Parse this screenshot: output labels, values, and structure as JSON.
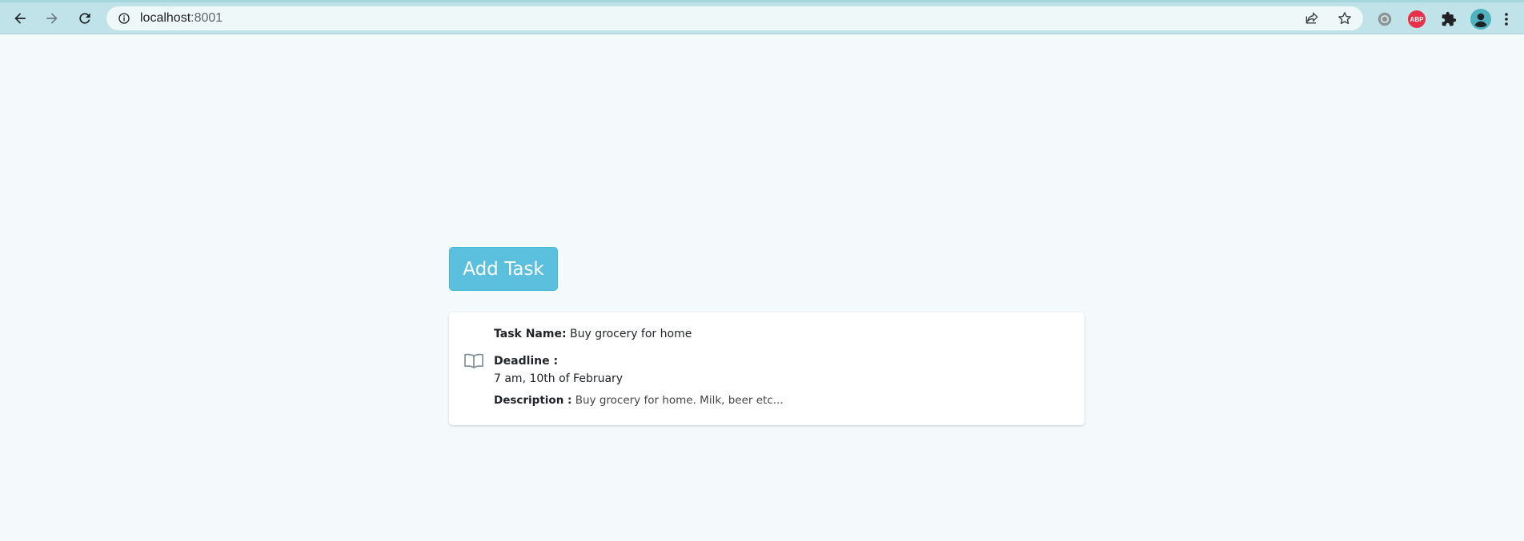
{
  "browser": {
    "url_host": "localhost",
    "url_port": ":8001",
    "icons": {
      "back": "arrow-left-icon",
      "forward": "arrow-right-icon",
      "reload": "reload-icon",
      "info": "info-icon",
      "share": "share-icon",
      "bookmark": "star-icon",
      "extension_1": "circle-extension-icon",
      "extension_abp": "adblock-plus-icon",
      "extensions": "puzzle-icon",
      "profile": "profile-icon",
      "menu": "kebab-menu-icon"
    },
    "abp_label": "ABP",
    "colors": {
      "chrome_bg": "#bfe3e8",
      "omnibox_bg": "#eef8f9",
      "abp_red": "#e8304a",
      "profile_teal": "#4fb3bf"
    }
  },
  "page": {
    "add_task_label": "Add Task",
    "colors": {
      "button_bg": "#5bc0de",
      "page_bg": "#f4f9fc",
      "card_bg": "#ffffff"
    },
    "tasks": [
      {
        "icon": "book-open-icon",
        "name_label": "Task Name:",
        "name_value": "Buy grocery for home",
        "deadline_label": "Deadline :",
        "deadline_value": "7 am, 10th of February",
        "description_label": "Description :",
        "description_value": "Buy grocery for home. Milk, beer etc..."
      }
    ]
  }
}
